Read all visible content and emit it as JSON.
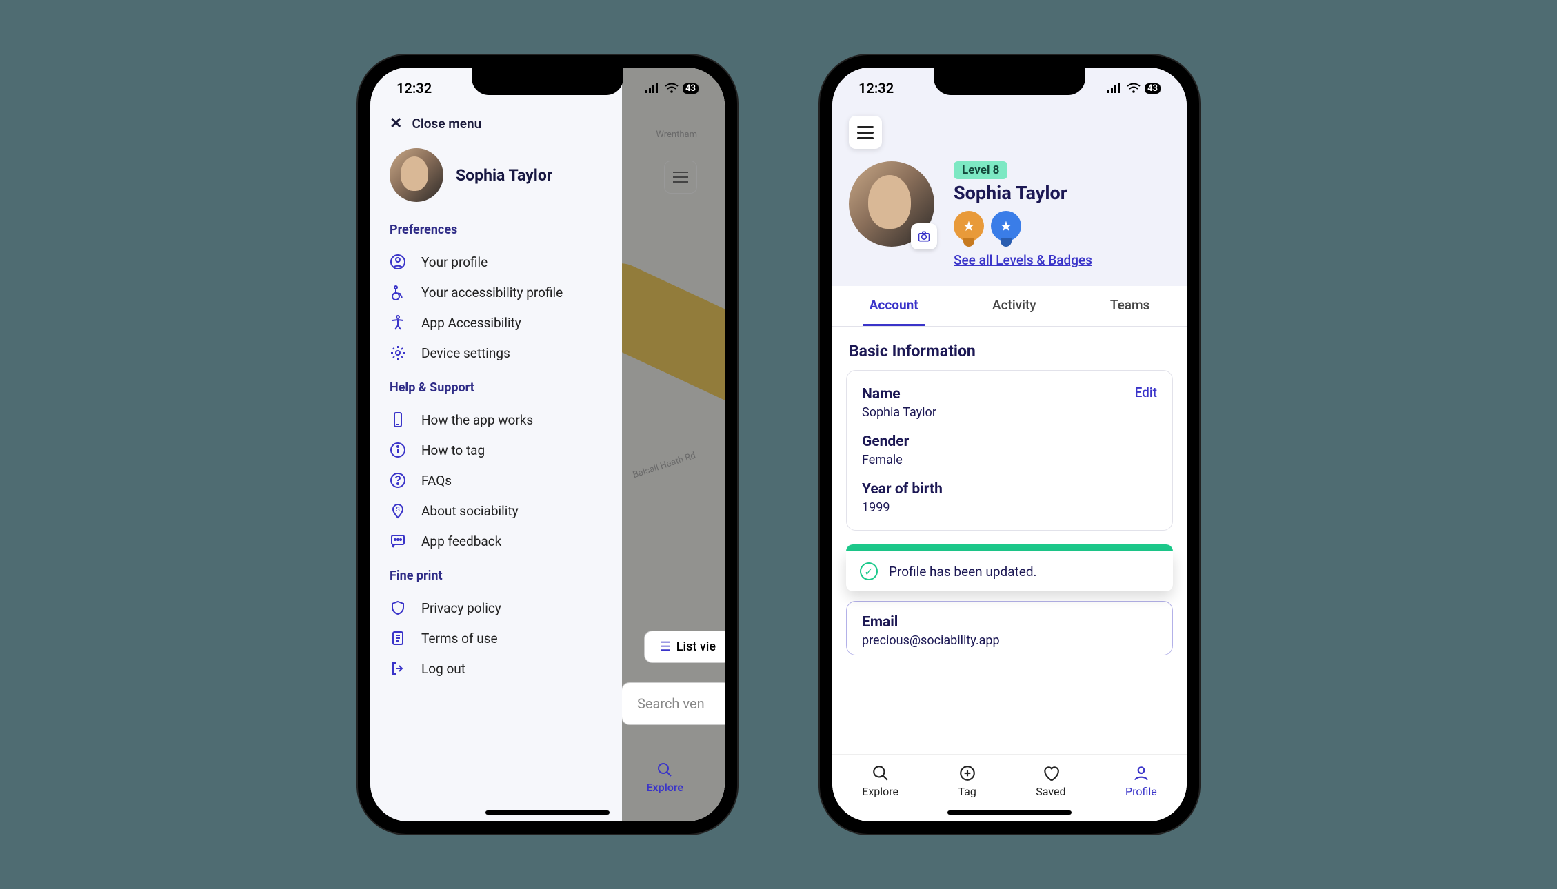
{
  "status": {
    "time": "12:32",
    "battery": "43"
  },
  "phone1": {
    "close_label": "Close menu",
    "user_name": "Sophia Taylor",
    "sections": {
      "preferences": {
        "title": "Preferences",
        "items": [
          "Your profile",
          "Your accessibility profile",
          "App Accessibility",
          "Device settings"
        ]
      },
      "help": {
        "title": "Help & Support",
        "items": [
          "How the app works",
          "How to tag",
          "FAQs",
          "About sociability",
          "App feedback"
        ]
      },
      "fine": {
        "title": "Fine print",
        "items": [
          "Privacy policy",
          "Terms of use",
          "Log out"
        ]
      }
    },
    "map": {
      "label_wrentham": "Wrentham",
      "label_balsall": "Balsall Heath Rd",
      "list_view": "List vie",
      "search_placeholder": "Search ven",
      "explore": "Explore"
    }
  },
  "phone2": {
    "level": "Level 8",
    "user_name": "Sophia Taylor",
    "see_all": "See all Levels & Badges",
    "tabs": [
      "Account",
      "Activity",
      "Teams"
    ],
    "section_title": "Basic Information",
    "edit": "Edit",
    "fields": {
      "name_label": "Name",
      "name_value": "Sophia Taylor",
      "gender_label": "Gender",
      "gender_value": "Female",
      "yob_label": "Year of birth",
      "yob_value": "1999",
      "email_label": "Email",
      "email_value": "precious@sociability.app"
    },
    "toast": "Profile has been updated.",
    "nav": [
      "Explore",
      "Tag",
      "Saved",
      "Profile"
    ]
  }
}
